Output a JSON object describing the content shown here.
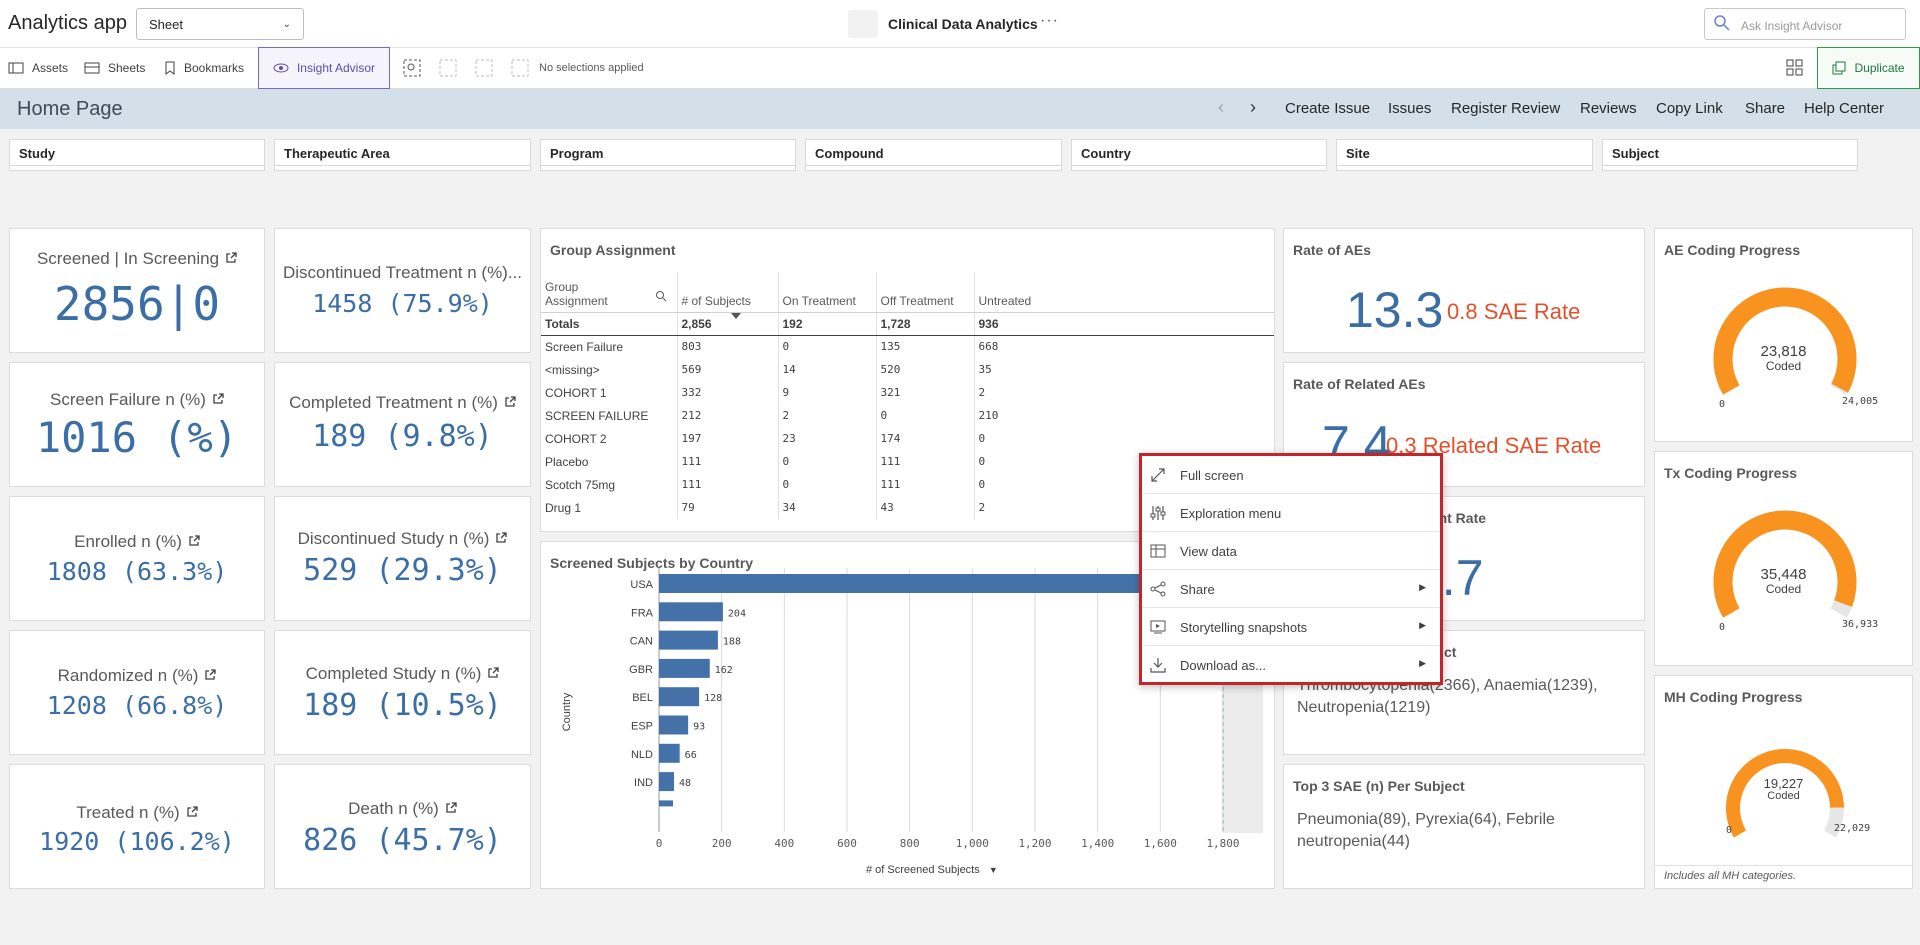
{
  "app": {
    "title": "Analytics app",
    "sheet_select": "Sheet",
    "center_title": "Clinical Data Analytics",
    "more": "···",
    "search_placeholder": "Ask Insight Advisor"
  },
  "toolbar": {
    "assets": "Assets",
    "sheets": "Sheets",
    "bookmarks": "Bookmarks",
    "insight_advisor": "Insight Advisor",
    "no_selections": "No selections applied",
    "duplicate": "Duplicate"
  },
  "header": {
    "page_title": "Home Page",
    "links": [
      "Create Issue",
      "Issues",
      "Register Review",
      "Reviews",
      "Copy Link",
      "Share",
      "Help Center"
    ]
  },
  "filters": [
    "Study",
    "Therapeutic Area",
    "Program",
    "Compound",
    "Country",
    "Site",
    "Subject"
  ],
  "kpis_left": [
    {
      "title": "Screened | In Screening",
      "value": "2856|0"
    },
    {
      "title": "Screen Failure n (%)",
      "value": "1016 (%)"
    },
    {
      "title": "Enrolled n (%)",
      "value": "1808 (63.3%)"
    },
    {
      "title": "Randomized n (%)",
      "value": "1208 (66.8%)"
    },
    {
      "title": "Treated n (%)",
      "value": "1920 (106.2%)"
    }
  ],
  "kpis_mid": [
    {
      "title": "Discontinued Treatment n (%)...",
      "value": "1458 (75.9%)"
    },
    {
      "title": "Completed Treatment n (%)",
      "value": "189 (9.8%)"
    },
    {
      "title": "Discontinued Study n (%)",
      "value": "529 (29.3%)"
    },
    {
      "title": "Completed Study n (%)",
      "value": "189 (10.5%)"
    },
    {
      "title": "Death n (%)",
      "value": "826 (45.7%)"
    }
  ],
  "group_assignment": {
    "title": "Group Assignment",
    "columns": [
      "Group Assignment",
      "# of Subjects",
      "On Treatment",
      "Off Treatment",
      "Untreated"
    ],
    "totals": [
      "Totals",
      "2,856",
      "192",
      "1,728",
      "936"
    ],
    "rows": [
      [
        "Screen Failure",
        "803",
        "0",
        "135",
        "668"
      ],
      [
        "<missing>",
        "569",
        "14",
        "520",
        "35"
      ],
      [
        "COHORT 1",
        "332",
        "9",
        "321",
        "2"
      ],
      [
        "SCREEN FAILURE",
        "212",
        "2",
        "0",
        "210"
      ],
      [
        "COHORT 2",
        "197",
        "23",
        "174",
        "0"
      ],
      [
        "Placebo",
        "111",
        "0",
        "111",
        "0"
      ],
      [
        "Scotch 75mg",
        "111",
        "0",
        "111",
        "0"
      ],
      [
        "Drug 1",
        "79",
        "34",
        "43",
        "2"
      ]
    ]
  },
  "country_chart": {
    "title": "Screened Subjects by Country",
    "xlabel": "# of Screened Subjects",
    "ylabel": "Country"
  },
  "chart_data": {
    "type": "bar",
    "orientation": "horizontal",
    "title": "Screened Subjects by Country",
    "xlabel": "# of Screened Subjects",
    "ylabel": "Country",
    "categories": [
      "USA",
      "FRA",
      "CAN",
      "GBR",
      "BEL",
      "ESP",
      "NLD",
      "IND"
    ],
    "values": [
      1800,
      204,
      188,
      162,
      128,
      93,
      66,
      48
    ],
    "value_labels": [
      "",
      "204",
      "188",
      "162",
      "128",
      "93",
      "66",
      "48"
    ],
    "xlim": [
      0,
      1800
    ],
    "xticks": [
      "0",
      "200",
      "400",
      "600",
      "800",
      "1,000",
      "1,200",
      "1,400",
      "1,600",
      "1,800"
    ],
    "grid": true
  },
  "rates": {
    "ae_title": "Rate of AEs",
    "ae_value": "13.3",
    "ae_sae": "0.8 SAE Rate",
    "related_title": "Rate of Related AEs",
    "related_value": "7.4",
    "related_sae": "0.3 Related SAE Rate",
    "emergent_title": "ergent Rate",
    "emergent_value": "0.7",
    "top3_partial_title": "ct",
    "top3_ae_text": "Thrombocytopenia(2366), Anaemia(1239), Neutropenia(1219)",
    "top3_sae_title": "Top 3 SAE (n) Per Subject",
    "top3_sae_text": "Pneumonia(89), Pyrexia(64), Febrile neutropenia(44)"
  },
  "coding": {
    "ae": {
      "title": "AE Coding Progress",
      "value": "23,818",
      "sub": "Coded",
      "min": "0",
      "max": "24,005",
      "fraction": 0.992
    },
    "tx": {
      "title": "Tx Coding Progress",
      "value": "35,448",
      "sub": "Coded",
      "min": "0",
      "max": "36,933",
      "fraction": 0.96
    },
    "mh": {
      "title": "MH Coding Progress",
      "value": "19,227",
      "sub": "Coded",
      "min": "0",
      "max": "22,029",
      "fraction": 0.873,
      "note": "Includes all MH categories."
    }
  },
  "context_menu": [
    {
      "label": "Full screen",
      "icon": "expand-icon",
      "submenu": false
    },
    {
      "label": "Exploration menu",
      "icon": "sliders-icon",
      "submenu": false
    },
    {
      "label": "View data",
      "icon": "table-icon",
      "submenu": false
    },
    {
      "label": "Share",
      "icon": "share-icon",
      "submenu": true
    },
    {
      "label": "Storytelling snapshots",
      "icon": "snapshot-icon",
      "submenu": true
    },
    {
      "label": "Download as...",
      "icon": "download-icon",
      "submenu": true
    }
  ],
  "colors": {
    "kpi_blue": "#3b6ea5",
    "sae_red": "#e4502c",
    "gauge_orange": "#f7931e",
    "gauge_track": "#e6e6e6",
    "bar_blue": "#4472a8",
    "menu_border": "#c2262c"
  }
}
